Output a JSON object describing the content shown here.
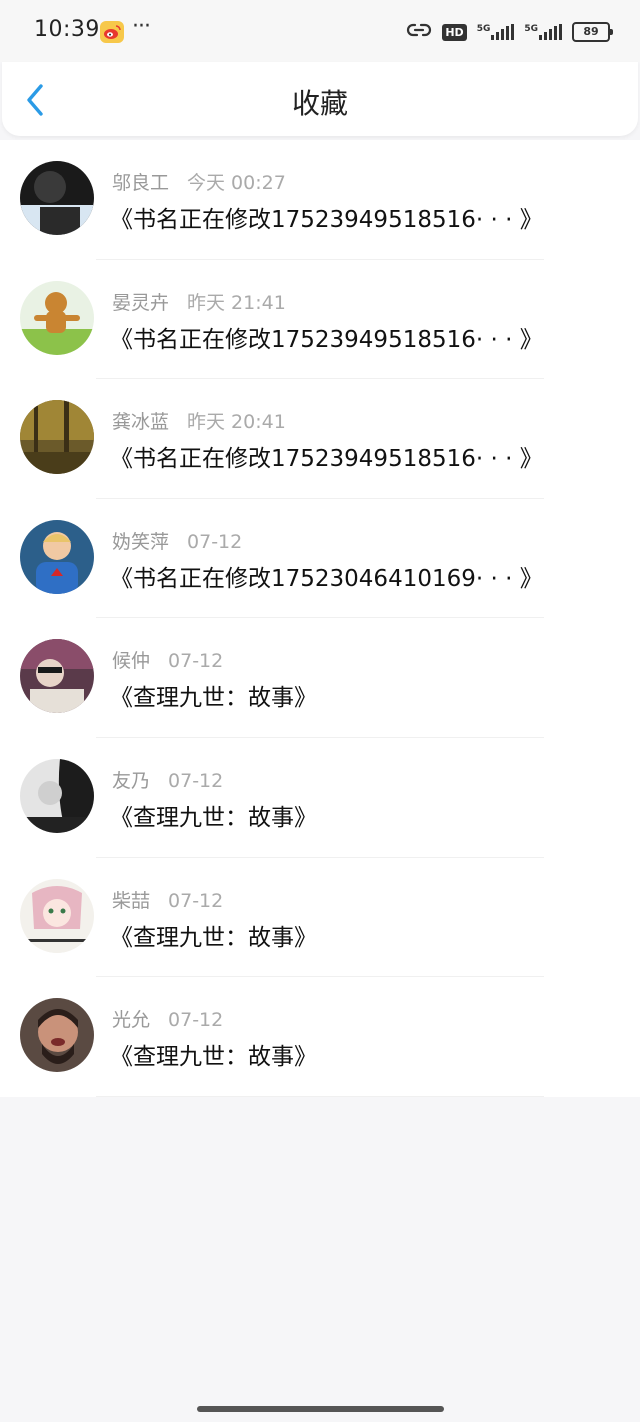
{
  "status_bar": {
    "time": "10:39",
    "more": "···",
    "hd": "HD",
    "network_1": "5G",
    "network_2": "5G",
    "battery": "89"
  },
  "header": {
    "title": "收藏"
  },
  "favorites": [
    {
      "name": "邬良工",
      "date": "今天 00:27",
      "title": "《书名正在修改17523949518516· · · 》"
    },
    {
      "name": "晏灵卉",
      "date": "昨天 21:41",
      "title": "《书名正在修改17523949518516· · · 》"
    },
    {
      "name": "龚冰蓝",
      "date": "昨天 20:41",
      "title": "《书名正在修改17523949518516· · · 》"
    },
    {
      "name": "妫笑萍",
      "date": "07-12",
      "title": "《书名正在修改17523046410169· · · 》"
    },
    {
      "name": "候仲",
      "date": "07-12",
      "title": "《查理九世：故事》"
    },
    {
      "name": "友乃",
      "date": "07-12",
      "title": "《查理九世：故事》"
    },
    {
      "name": "柴喆",
      "date": "07-12",
      "title": "《查理九世：故事》"
    },
    {
      "name": "光允",
      "date": "07-12",
      "title": "《查理九世：故事》"
    }
  ],
  "colors": {
    "accent": "#2b9be6",
    "background": "#f6f6f8",
    "name_text": "#999999",
    "title_text": "#111111"
  },
  "icons": {
    "back": "chevron-left-icon",
    "weibo": "weibo-icon"
  }
}
